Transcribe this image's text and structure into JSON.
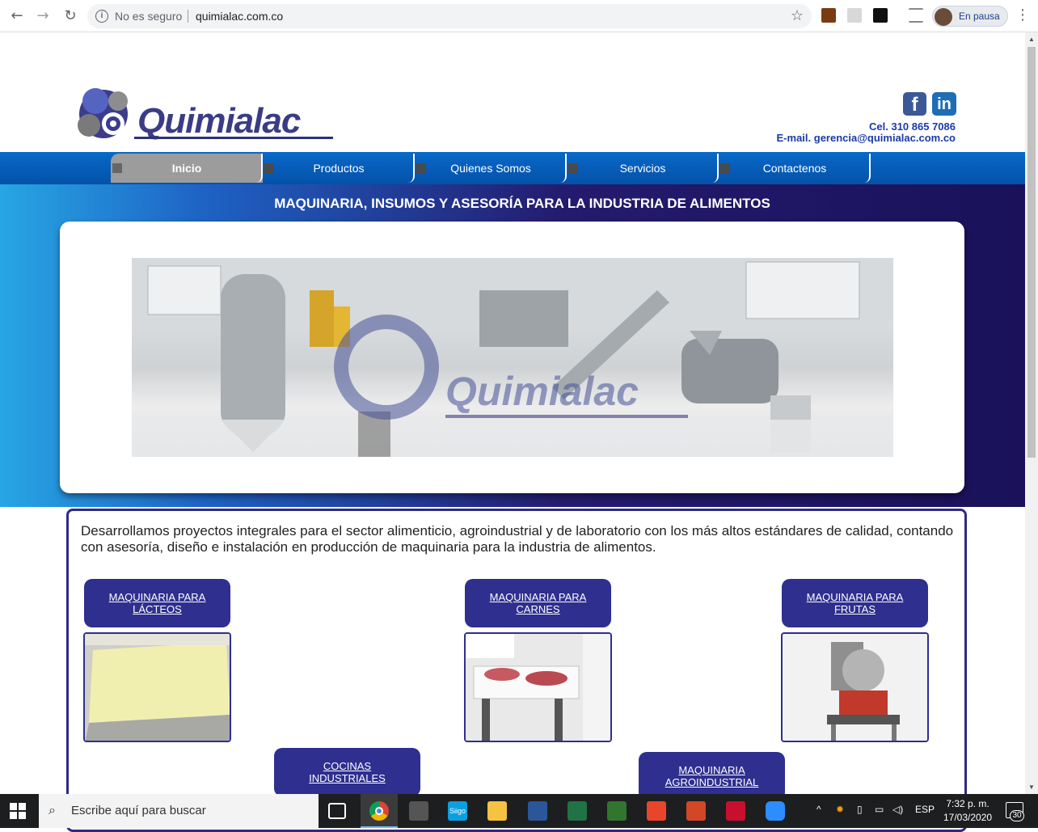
{
  "browser": {
    "security": "No es seguro",
    "url": "quimialac.com.co",
    "profile_status": "En pausa"
  },
  "site": {
    "logo_text": "Quimialac",
    "cel": "Cel. 310 865 7086",
    "email": "E-mail. gerencia@quimialac.com.co",
    "nav": [
      "Inicio",
      "Productos",
      "Quienes Somos",
      "Servicios",
      "Contactenos"
    ],
    "hero_title": "MAQUINARIA, INSUMOS Y ASESORÍA PARA LA INDUSTRIA DE ALIMENTOS",
    "intro": "Desarrollamos proyectos integrales para el sector alimenticio, agroindustrial y de laboratorio con los más altos estándares de calidad, contando con asesoría, diseño e instalación en producción de maquinaria para la industria de alimentos.",
    "categories": {
      "lacteos": "MAQUINARIA PARA LÁCTEOS",
      "carnes": "MAQUINARIA PARA CARNES",
      "frutas": "MAQUINARIA PARA FRUTAS",
      "cocinas": "COCINAS INDUSTRIALES",
      "agro": "MAQUINARIA AGROINDUSTRIAL"
    }
  },
  "taskbar": {
    "search_placeholder": "Escribe aquí para buscar",
    "lang": "ESP",
    "time": "7:32 p. m.",
    "date": "17/03/2020",
    "notifications": "30",
    "siigo": "Siigo"
  },
  "colors": {
    "brand": "#2e2f8f",
    "nav": "#0868c8",
    "accent": "#1a3aa8"
  }
}
